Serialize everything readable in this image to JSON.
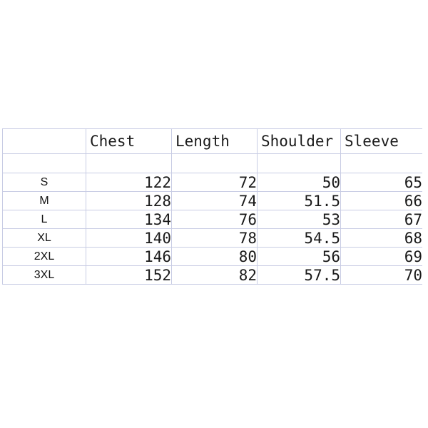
{
  "chart_data": {
    "type": "table",
    "title": "",
    "columns": [
      "",
      "Chest",
      "Length",
      "Shoulder",
      "Sleeve"
    ],
    "row_header_label": "",
    "categories": [
      "S",
      "M",
      "L",
      "XL",
      "2XL",
      "3XL"
    ],
    "series": [
      {
        "name": "Chest",
        "values": [
          122,
          128,
          134,
          140,
          146,
          152
        ]
      },
      {
        "name": "Length",
        "values": [
          72,
          74,
          76,
          78,
          80,
          82
        ]
      },
      {
        "name": "Shoulder",
        "values": [
          50,
          51.5,
          53,
          54.5,
          56,
          57.5
        ]
      },
      {
        "name": "Sleeve",
        "values": [
          65,
          66,
          67,
          68,
          69,
          70
        ]
      }
    ],
    "xlabel": "",
    "ylabel": "",
    "grid": true,
    "legend": "none"
  },
  "table": {
    "headers": {
      "corner": "",
      "chest": "Chest",
      "length": "Length",
      "shoulder": "Shoulder",
      "sleeve": "Sleeve"
    },
    "spacer_row": {
      "size": "",
      "chest": "",
      "length": "",
      "shoulder": "",
      "sleeve": ""
    },
    "rows": [
      {
        "size": "S",
        "chest": "122",
        "length": "72",
        "shoulder": "50",
        "sleeve": "65"
      },
      {
        "size": "M",
        "chest": "128",
        "length": "74",
        "shoulder": "51.5",
        "sleeve": "66"
      },
      {
        "size": "L",
        "chest": "134",
        "length": "76",
        "shoulder": "53",
        "sleeve": "67"
      },
      {
        "size": "XL",
        "chest": "140",
        "length": "78",
        "shoulder": "54.5",
        "sleeve": "68"
      },
      {
        "size": "2XL",
        "chest": "146",
        "length": "80",
        "shoulder": "56",
        "sleeve": "69"
      },
      {
        "size": "3XL",
        "chest": "152",
        "length": "82",
        "shoulder": "57.5",
        "sleeve": "70"
      }
    ]
  },
  "colors": {
    "background": "#ffffff",
    "grid_line": "#c8cce4",
    "header_text": "#1a1a1a",
    "body_text": "#1a1a1a",
    "size_label_text": "#111111"
  }
}
